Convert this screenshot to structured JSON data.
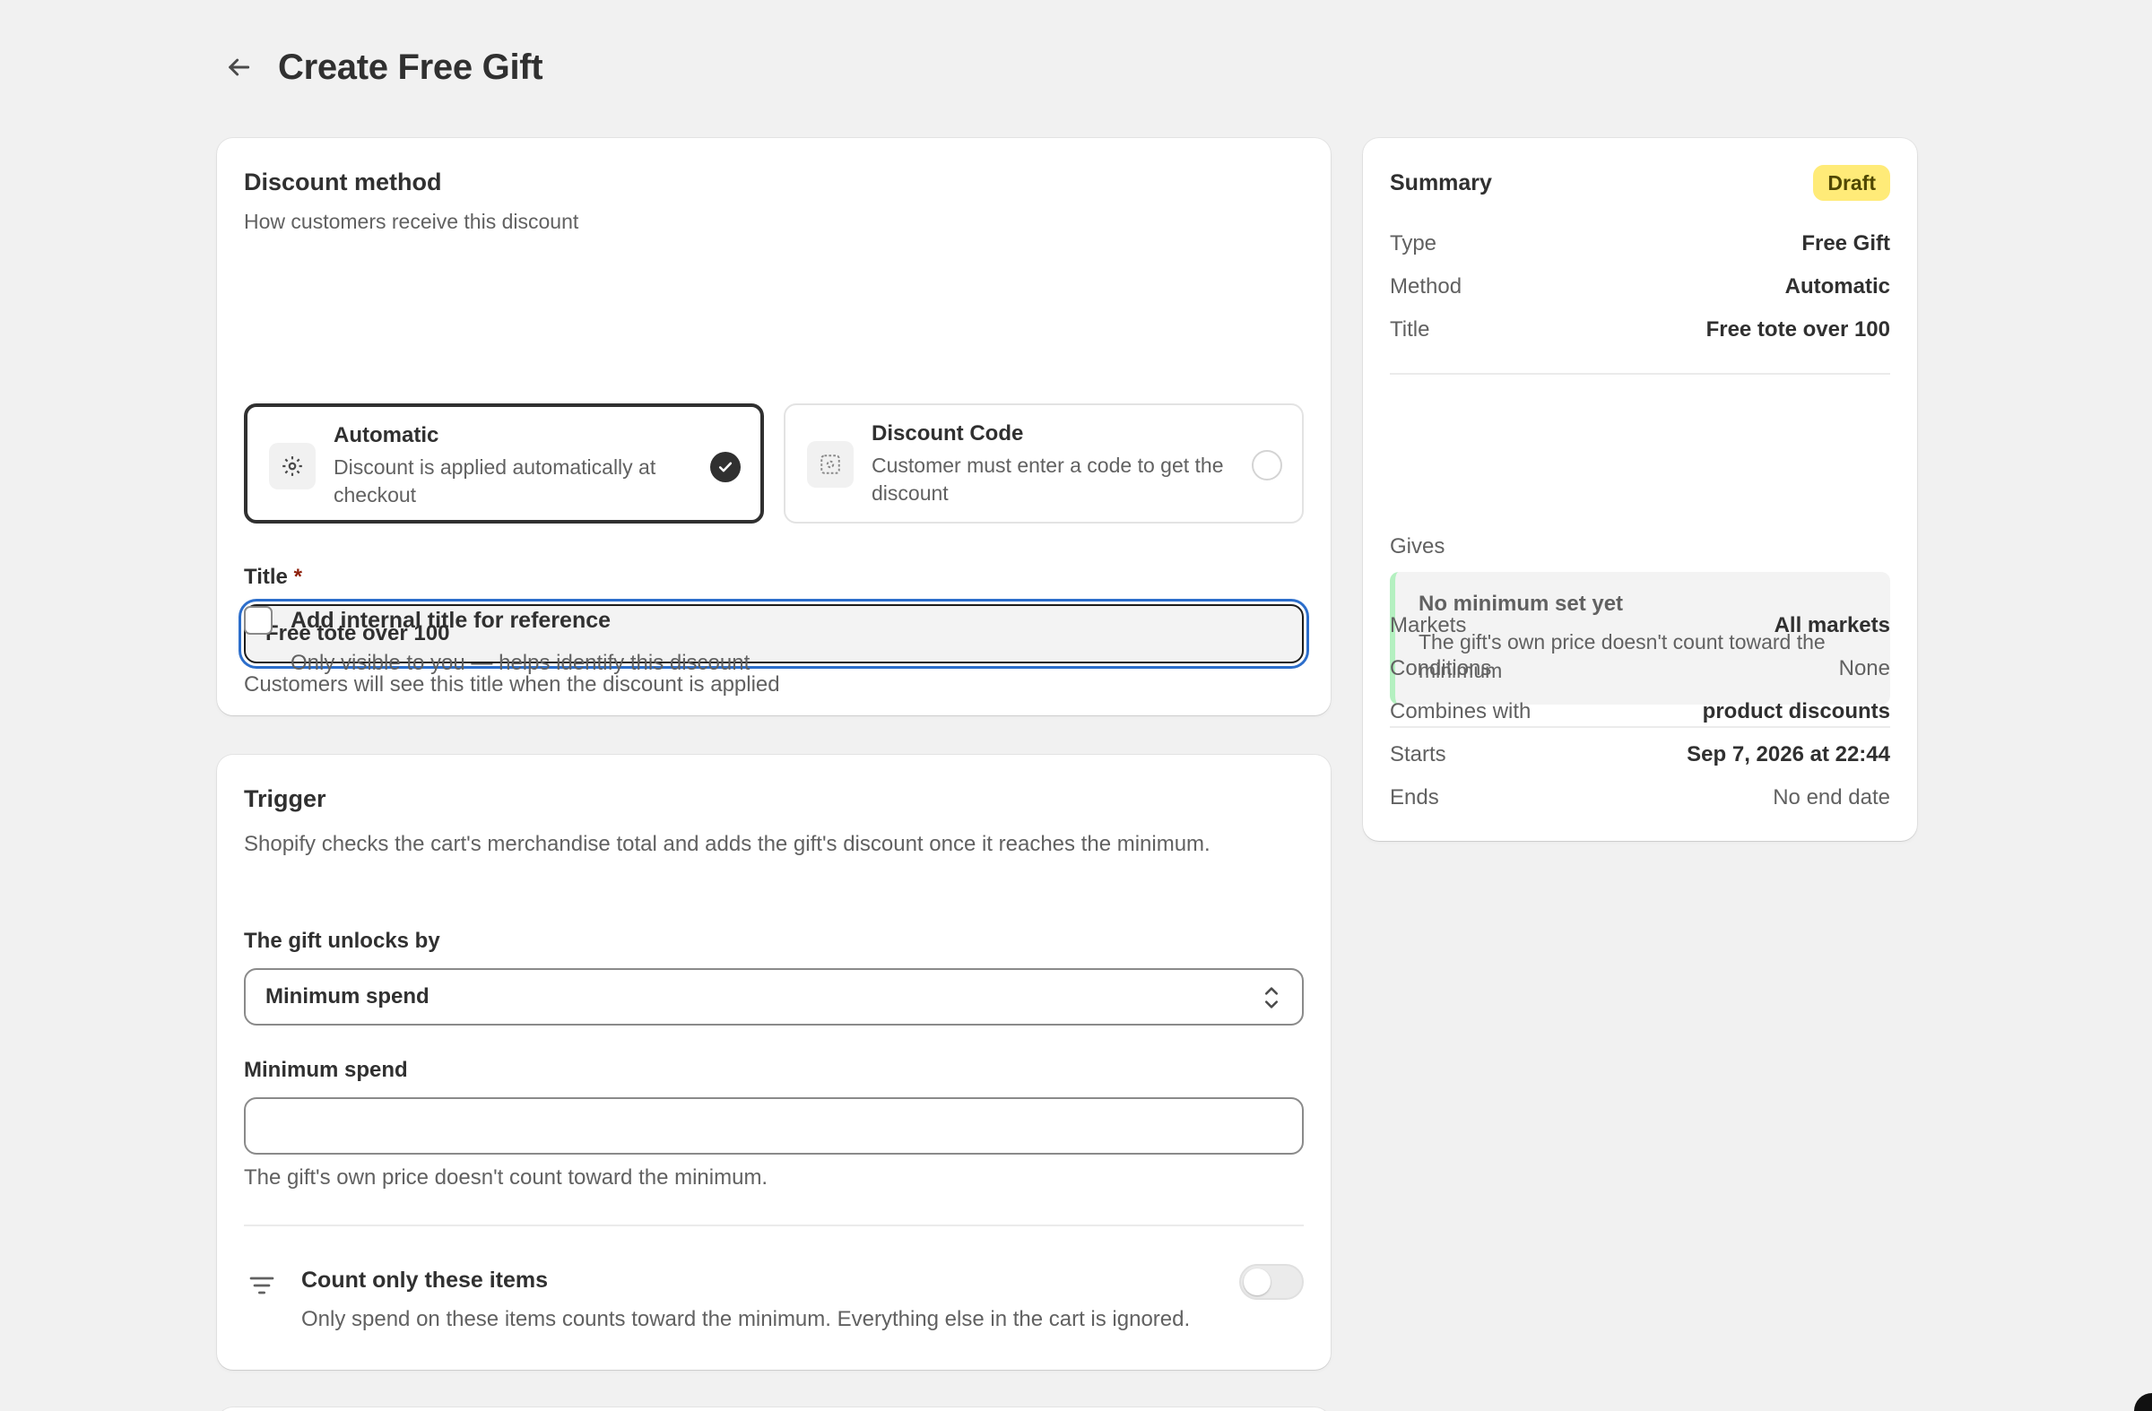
{
  "header": {
    "title": "Create Free Gift"
  },
  "discount_method": {
    "heading": "Discount method",
    "subheading": "How customers receive this discount",
    "options": [
      {
        "title": "Automatic",
        "description": "Discount is applied automatically at checkout",
        "selected": true,
        "icon": "gear-icon"
      },
      {
        "title": "Discount Code",
        "description": "Customer must enter a code to get the discount",
        "selected": false,
        "icon": "code-icon"
      }
    ],
    "title_label": "Title",
    "required_mark": "*",
    "title_value": "Free tote over 100",
    "title_help": "Customers will see this title when the discount is applied",
    "internal_title_label": "Add internal title for reference",
    "internal_title_help": "Only visible to you — helps identify this discount"
  },
  "trigger": {
    "heading": "Trigger",
    "description": "Shopify checks the cart's merchandise total and adds the gift's discount once it reaches the minimum.",
    "unlock_label": "The gift unlocks by",
    "unlock_value": "Minimum spend",
    "min_spend_label": "Minimum spend",
    "min_spend_value": "",
    "min_spend_help": "The gift's own price doesn't count toward the minimum.",
    "count_items_label": "Count only these items",
    "count_items_help": "Only spend on these items counts toward the minimum. Everything else in the cart is ignored.",
    "count_items_enabled": false
  },
  "summary": {
    "title": "Summary",
    "badge": "Draft",
    "rows_top": [
      {
        "key": "Type",
        "value": "Free Gift"
      },
      {
        "key": "Method",
        "value": "Automatic"
      },
      {
        "key": "Title",
        "value": "Free tote over 100"
      }
    ],
    "gives_label": "Gives",
    "gives_title": "No minimum set yet",
    "gives_desc": "The gift's own price doesn't count toward the minimum",
    "rows_bottom": [
      {
        "key": "Markets",
        "value": "All markets"
      },
      {
        "key": "Conditions",
        "value": "None"
      },
      {
        "key": "Combines with",
        "value": "product discounts"
      },
      {
        "key": "Starts",
        "value": "Sep 7, 2026 at 22:44"
      },
      {
        "key": "Ends",
        "value": "No end date"
      }
    ]
  },
  "colors": {
    "page_bg": "#f1f1f1",
    "focus_ring": "#2c6ecb",
    "badge_bg": "#ffeb78",
    "gives_accent": "#b4f0c0"
  }
}
